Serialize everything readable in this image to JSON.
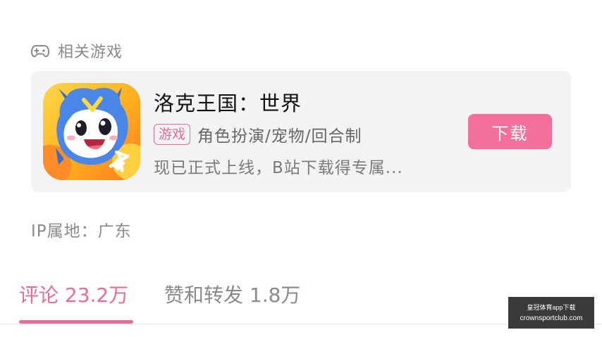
{
  "related_games": {
    "title": "相关游戏",
    "icon": "gamepad-icon",
    "game": {
      "name": "洛克王国：世界",
      "tag": "游戏",
      "genre": "角色扮演/宠物/回合制",
      "description": "现已正式上线，B站下载得专属...",
      "download_label": "下载",
      "icon": "game-app-icon"
    }
  },
  "ip_location": "IP属地：广东",
  "tabs": {
    "comments": "评论 23.2万",
    "likes_shares": "赞和转发 1.8万"
  },
  "watermark": {
    "line1": "皇冠体育app下载",
    "line2": "crownsportclub.com"
  },
  "colors": {
    "accent": "#ea6b96",
    "download_button": "#f2709a",
    "card_background": "#f3f3f5",
    "muted_text": "#8a8a8a"
  }
}
